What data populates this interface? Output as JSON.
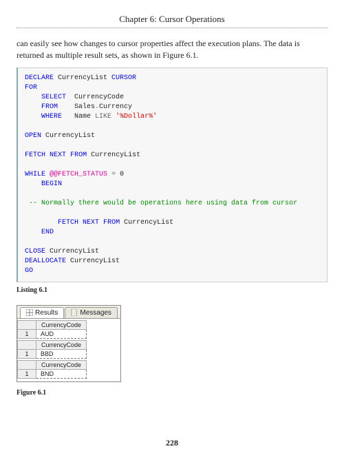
{
  "chapter": {
    "header": "Chapter 6: Cursor Operations"
  },
  "intro": "can easily see how changes to cursor properties affect the execution plans. The data is returned as multiple result sets, as shown in Figure 6.1.",
  "code": {
    "l1a": "DECLARE",
    "l1b": " CurrencyList ",
    "l1c": "CURSOR",
    "l2": "FOR",
    "l3a": "    SELECT",
    "l3b": "  CurrencyCode",
    "l4a": "    FROM",
    "l4b": "    Sales",
    "l4c": ".",
    "l4d": "Currency",
    "l5a": "    WHERE",
    "l5b": "   Name ",
    "l5c": "LIKE",
    "l5d": " ",
    "l5e": "'%Dollar%'",
    "l6a": "OPEN",
    "l6b": " CurrencyList",
    "l7a": "FETCH",
    "l7b": " ",
    "l7c": "NEXT",
    "l7d": " ",
    "l7e": "FROM",
    "l7f": " CurrencyList",
    "l8a": "WHILE",
    "l8b": " ",
    "l8c": "@@FETCH_STATUS",
    "l8d": " ",
    "l8e": "=",
    "l8f": " 0",
    "l9": "    BEGIN",
    "l10": " -- Normally there would be operations here using data from cursor",
    "l11a": "        FETCH",
    "l11b": " ",
    "l11c": "NEXT",
    "l11d": " ",
    "l11e": "FROM",
    "l11f": " CurrencyList",
    "l12": "    END",
    "l13a": "CLOSE",
    "l13b": " CurrencyList",
    "l14a": "DEALLOCATE",
    "l14b": " CurrencyList",
    "l15": "GO"
  },
  "listing_caption": "Listing 6.1",
  "results": {
    "tab_results": "Results",
    "tab_messages": "Messages",
    "grids": [
      {
        "header": "CurrencyCode",
        "rownum": "1",
        "value": "AUD"
      },
      {
        "header": "CurrencyCode",
        "rownum": "1",
        "value": "BBD"
      },
      {
        "header": "CurrencyCode",
        "rownum": "1",
        "value": "BND"
      }
    ]
  },
  "figure_caption": "Figure 6.1",
  "page_number": "228"
}
